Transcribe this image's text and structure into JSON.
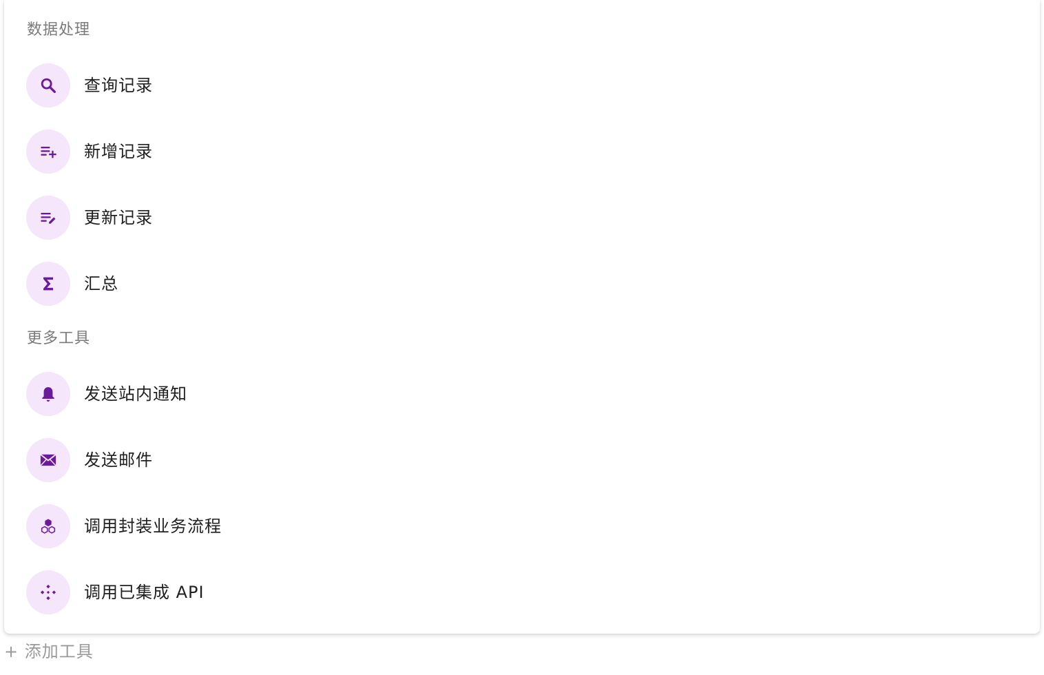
{
  "sections": [
    {
      "title": "数据处理",
      "items": [
        {
          "label": "查询记录",
          "icon": "search-icon"
        },
        {
          "label": "新增记录",
          "icon": "playlist-add-icon"
        },
        {
          "label": "更新记录",
          "icon": "edit-list-icon"
        },
        {
          "label": "汇总",
          "icon": "sigma-icon"
        }
      ]
    },
    {
      "title": "更多工具",
      "items": [
        {
          "label": "发送站内通知",
          "icon": "bell-icon"
        },
        {
          "label": "发送邮件",
          "icon": "mail-icon"
        },
        {
          "label": "调用封装业务流程",
          "icon": "workflow-icon"
        },
        {
          "label": "调用已集成 API",
          "icon": "api-icon"
        }
      ]
    }
  ],
  "add_tool_label": "+ 添加工具",
  "colors": {
    "icon": "#6a1b9a",
    "icon_bg": "#f5e6fb",
    "section_title": "#7a7a7a",
    "label": "#1f1f1f"
  }
}
